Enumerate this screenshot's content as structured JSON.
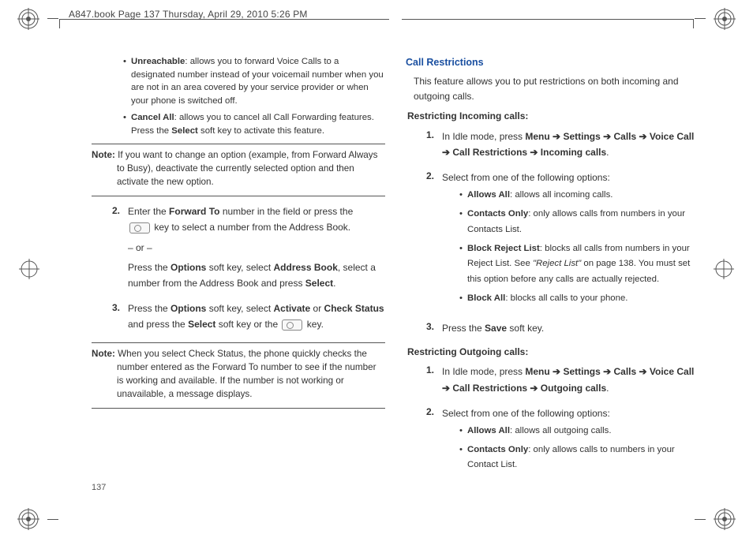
{
  "header": {
    "text": "A847.book  Page 137  Thursday, April 29, 2010  5:26 PM"
  },
  "left": {
    "bullets": [
      {
        "title": "Unreachable",
        "rest": ": allows you to forward Voice Calls to a designated number instead of your voicemail number when you are not in an area covered by your service provider or when your phone is switched off."
      },
      {
        "title": "Cancel All",
        "rest_a": ": allows you to cancel all Call Forwarding features. Press the ",
        "rest_bold": "Select",
        "rest_b": " soft key to activate this feature."
      }
    ],
    "note1": {
      "label": "Note:",
      "text": " If you want to change an option (example, from Forward Always to Busy), deactivate the currently selected option and then activate the new option."
    },
    "steps": {
      "s2": {
        "num": "2.",
        "line1_a": "Enter the ",
        "line1_b": "Forward To",
        "line1_c": " number in the field or press the",
        "line2": " key to select a number from the Address Book.",
        "or": "– or –",
        "line3_a": "Press the ",
        "line3_b": "Options",
        "line3_c": " soft key, select ",
        "line3_d": "Address Book",
        "line3_e": ", select a number from the Address Book and press ",
        "line3_f": "Select",
        "line3_g": "."
      },
      "s3": {
        "num": "3.",
        "line1_a": "Press the ",
        "line1_b": "Options",
        "line1_c": " soft key, select ",
        "line1_d": "Activate",
        "line1_e": " or ",
        "line1_f": "Check Status",
        "line1_g": " and press the ",
        "line1_h": "Select",
        "line1_i": " soft key or the ",
        "line1_j": " key."
      }
    },
    "note2": {
      "label": "Note:",
      "text": " When you select Check Status, the phone quickly checks the number entered as the Forward To number to see if the number is working and available. If the number is not working or unavailable, a message displays."
    }
  },
  "right": {
    "title": "Call Restrictions",
    "intro": "This feature allows you to put restrictions on both incoming and outgoing calls.",
    "incoming": {
      "head": "Restricting Incoming calls:",
      "s1": {
        "num": "1.",
        "a": "In Idle mode, press ",
        "path": "Menu ➔ Settings ➔ Calls ➔ Voice Call ➔ Call Restrictions ➔ Incoming calls",
        "b": "."
      },
      "s2": {
        "num": "2.",
        "a": "Select from one of the following options:"
      },
      "bullets": [
        {
          "title": "Allows All",
          "rest": ": allows all incoming calls."
        },
        {
          "title": "Contacts Only",
          "rest": ": only allows calls from numbers in your Contacts List."
        },
        {
          "title": "Block Reject List",
          "rest_a": ": blocks all calls from numbers in your Reject List. See ",
          "ital": "\"Reject List\"",
          "rest_b": " on page 138. You must set this option before any calls are actually rejected."
        },
        {
          "title": "Block All",
          "rest": ": blocks all calls to your phone."
        }
      ],
      "s3": {
        "num": "3.",
        "a": "Press the ",
        "b": "Save",
        "c": " soft key."
      }
    },
    "outgoing": {
      "head": "Restricting Outgoing calls:",
      "s1": {
        "num": "1.",
        "a": "In Idle mode, press ",
        "path": "Menu ➔ Settings ➔ Calls ➔ Voice Call ➔ Call Restrictions ➔ Outgoing calls",
        "b": "."
      },
      "s2": {
        "num": "2.",
        "a": "Select from one of the following options:"
      },
      "bullets": [
        {
          "title": "Allows All",
          "rest": ": allows all outgoing calls."
        },
        {
          "title": "Contacts Only",
          "rest": ": only allows calls to numbers in your Contact List."
        }
      ]
    }
  },
  "page_number": "137"
}
